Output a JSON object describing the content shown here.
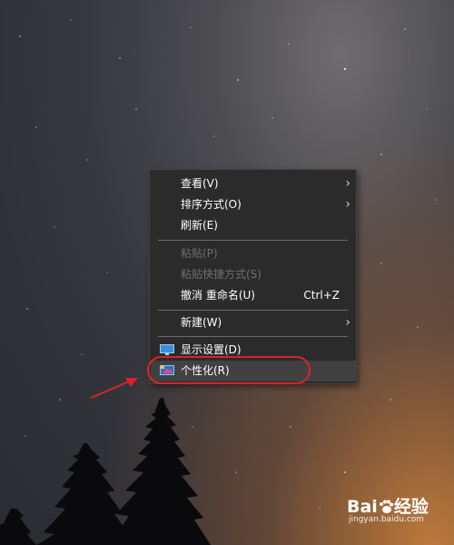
{
  "context_menu": {
    "items": [
      {
        "label": "查看(V)",
        "submenu": true
      },
      {
        "label": "排序方式(O)",
        "submenu": true
      },
      {
        "label": "刷新(E)"
      },
      {
        "label": "粘贴(P)",
        "disabled": true
      },
      {
        "label": "粘贴快捷方式(S)",
        "disabled": true
      },
      {
        "label": "撤消 重命名(U)",
        "shortcut": "Ctrl+Z"
      },
      {
        "label": "新建(W)",
        "submenu": true
      },
      {
        "label": "显示设置(D)",
        "icon": "display-icon"
      },
      {
        "label": "个性化(R)",
        "icon": "personalize-icon",
        "highlighted": true
      }
    ]
  },
  "annotation": {
    "color": "#d8232a"
  },
  "watermark": {
    "logo_part1": "Bai",
    "logo_part2": "经验",
    "url": "jingyan.baidu.com"
  },
  "colors": {
    "menu_bg": "#2b2b2b",
    "hover_bg": "#414141",
    "disabled_text": "#6e6e6e"
  }
}
